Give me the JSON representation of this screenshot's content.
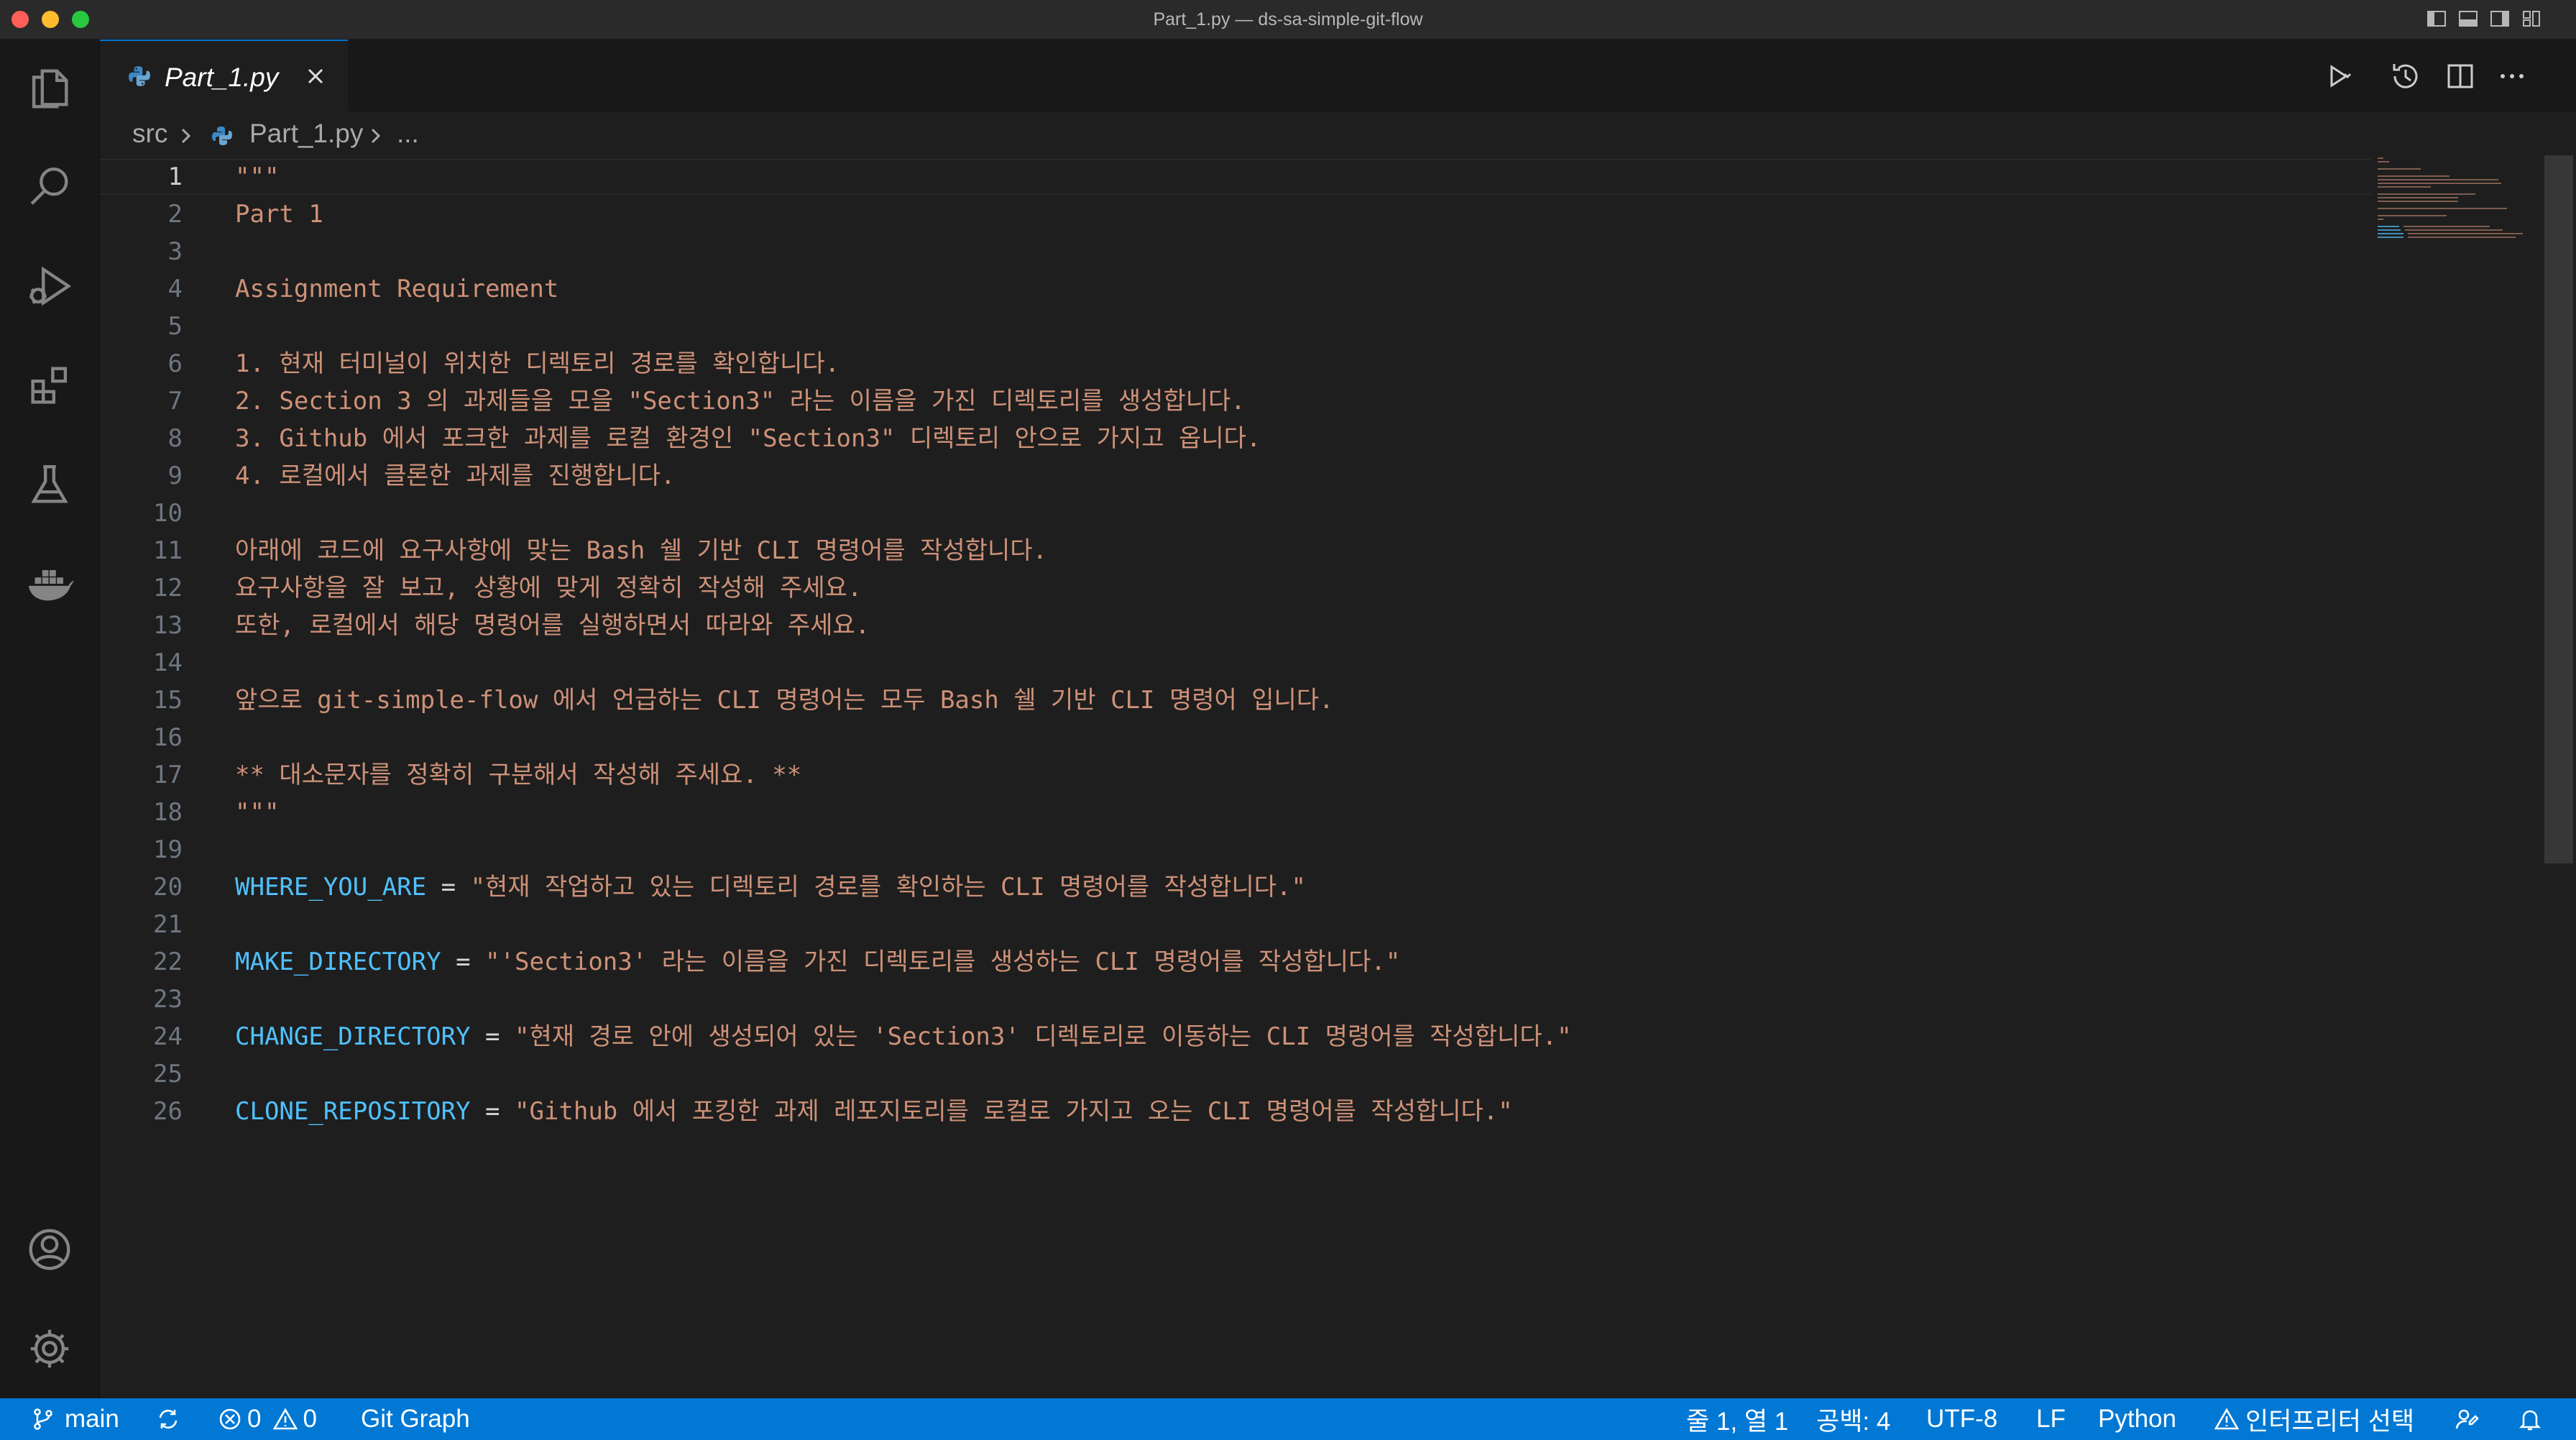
{
  "window": {
    "title": "Part_1.py — ds-sa-simple-git-flow"
  },
  "activity_bar": {
    "items": [
      "explorer-icon",
      "search-icon",
      "run-debug-icon",
      "extensions-icon",
      "testing-icon",
      "docker-icon"
    ],
    "bottom": [
      "account-icon",
      "manage-gear-icon"
    ]
  },
  "tab": {
    "label": "Part_1.py",
    "icon": "python-file-icon"
  },
  "breadcrumb": {
    "folder": "src",
    "file": "Part_1.py",
    "symbol": "..."
  },
  "editor": {
    "current_line": 1,
    "lines": [
      {
        "n": "1",
        "t": "\"\"\""
      },
      {
        "n": "2",
        "t": "Part 1"
      },
      {
        "n": "3",
        "t": ""
      },
      {
        "n": "4",
        "t": "Assignment Requirement"
      },
      {
        "n": "5",
        "t": ""
      },
      {
        "n": "6",
        "t": "1. 현재 터미널이 위치한 디렉토리 경로를 확인합니다."
      },
      {
        "n": "7",
        "t": "2. Section 3 의 과제들을 모을 \"Section3\" 라는 이름을 가진 디렉토리를 생성합니다."
      },
      {
        "n": "8",
        "t": "3. Github 에서 포크한 과제를 로컬 환경인 \"Section3\" 디렉토리 안으로 가지고 옵니다."
      },
      {
        "n": "9",
        "t": "4. 로컬에서 클론한 과제를 진행합니다."
      },
      {
        "n": "10",
        "t": ""
      },
      {
        "n": "11",
        "t": "아래에 코드에 요구사항에 맞는 Bash 쉘 기반 CLI 명령어를 작성합니다."
      },
      {
        "n": "12",
        "t": "요구사항을 잘 보고, 상황에 맞게 정확히 작성해 주세요."
      },
      {
        "n": "13",
        "t": "또한, 로컬에서 해당 명령어를 실행하면서 따라와 주세요."
      },
      {
        "n": "14",
        "t": ""
      },
      {
        "n": "15",
        "t": "앞으로 git-simple-flow 에서 언급하는 CLI 명령어는 모두 Bash 쉘 기반 CLI 명령어 입니다."
      },
      {
        "n": "16",
        "t": ""
      },
      {
        "n": "17",
        "t": "** 대소문자를 정확히 구분해서 작성해 주세요. **"
      },
      {
        "n": "18",
        "t": "\"\"\""
      },
      {
        "n": "19",
        "t": ""
      },
      {
        "n": "20",
        "v": "WHERE_YOU_ARE",
        "s": "\"현재 작업하고 있는 디렉토리 경로를 확인하는 CLI 명령어를 작성합니다.\""
      },
      {
        "n": "21",
        "t": ""
      },
      {
        "n": "22",
        "v": "MAKE_DIRECTORY",
        "s": "\"'Section3' 라는 이름을 가진 디렉토리를 생성하는 CLI 명령어를 작성합니다.\""
      },
      {
        "n": "23",
        "t": ""
      },
      {
        "n": "24",
        "v": "CHANGE_DIRECTORY",
        "s": "\"현재 경로 안에 생성되어 있는 'Section3' 디렉토리로 이동하는 CLI 명령어를 작성합니다.\""
      },
      {
        "n": "25",
        "t": ""
      },
      {
        "n": "26",
        "v": "CLONE_REPOSITORY",
        "s": "\"Github 에서 포킹한 과제 레포지토리를 로컬로 가지고 오는 CLI 명령어를 작성합니다.\""
      }
    ],
    "operator": "="
  },
  "status_bar": {
    "branch": "main",
    "errors": "0",
    "warnings": "0",
    "git_graph": "Git Graph",
    "cursor": "줄 1, 열 1",
    "spaces": "공백: 4",
    "encoding": "UTF-8",
    "eol": "LF",
    "language": "Python",
    "interpreter": "인터프리터 선택"
  },
  "colors": {
    "status_bar": "#0078d4",
    "string": "#ce9178",
    "variable": "#4fc1ff",
    "editor_bg": "#1e1e1e",
    "sidebar_bg": "#181818"
  }
}
